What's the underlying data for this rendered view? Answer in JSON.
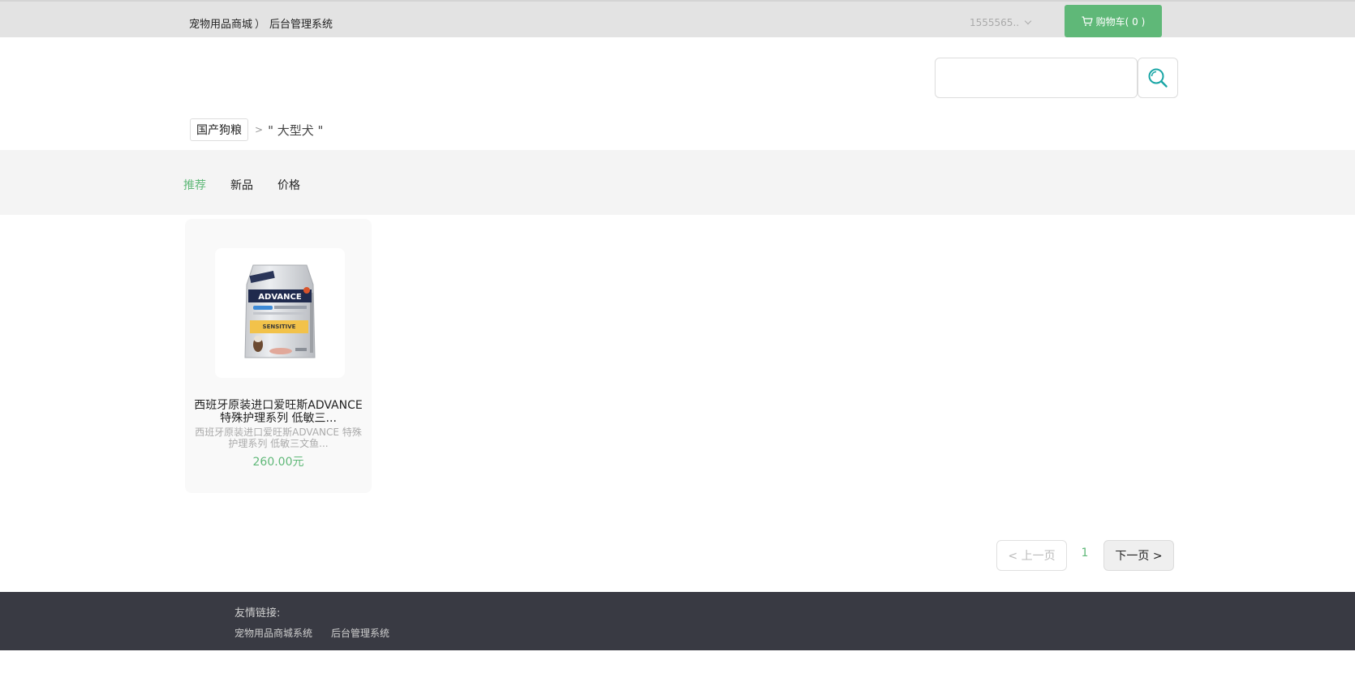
{
  "header": {
    "brand_name": "宠物用品商城",
    "separator": "）",
    "admin_link": "后台管理系统",
    "username": "1555565..",
    "cart_label": "购物车( 0 )"
  },
  "search": {
    "placeholder": "",
    "value": ""
  },
  "breadcrumb": {
    "category": "国产狗粮",
    "separator": ">",
    "keyword": "\" 大型犬 \""
  },
  "sort_options": [
    {
      "label": "推荐",
      "active": true
    },
    {
      "label": "新品",
      "active": false
    },
    {
      "label": "价格",
      "active": false
    }
  ],
  "products": [
    {
      "title": "西班牙原装进口爱旺斯ADVANCE 特殊护理系列 低敏三...",
      "description": "西班牙原装进口爱旺斯ADVANCE 特殊护理系列 低敏三文鱼...",
      "price": "260.00元",
      "image_text": {
        "brand": "ADVANCE",
        "variant": "SENSITIVE"
      }
    }
  ],
  "pagination": {
    "prev_label": "< 上一页",
    "current_page": "1",
    "next_label": "下一页 >"
  },
  "footer": {
    "title": "友情链接:",
    "links": [
      "宠物用品商城系统",
      "后台管理系统"
    ]
  },
  "colors": {
    "accent": "#5fb878",
    "footer_bg": "#393a43",
    "topbar_bg": "#e3e3e3",
    "search_icon": "#1aa6a6"
  }
}
